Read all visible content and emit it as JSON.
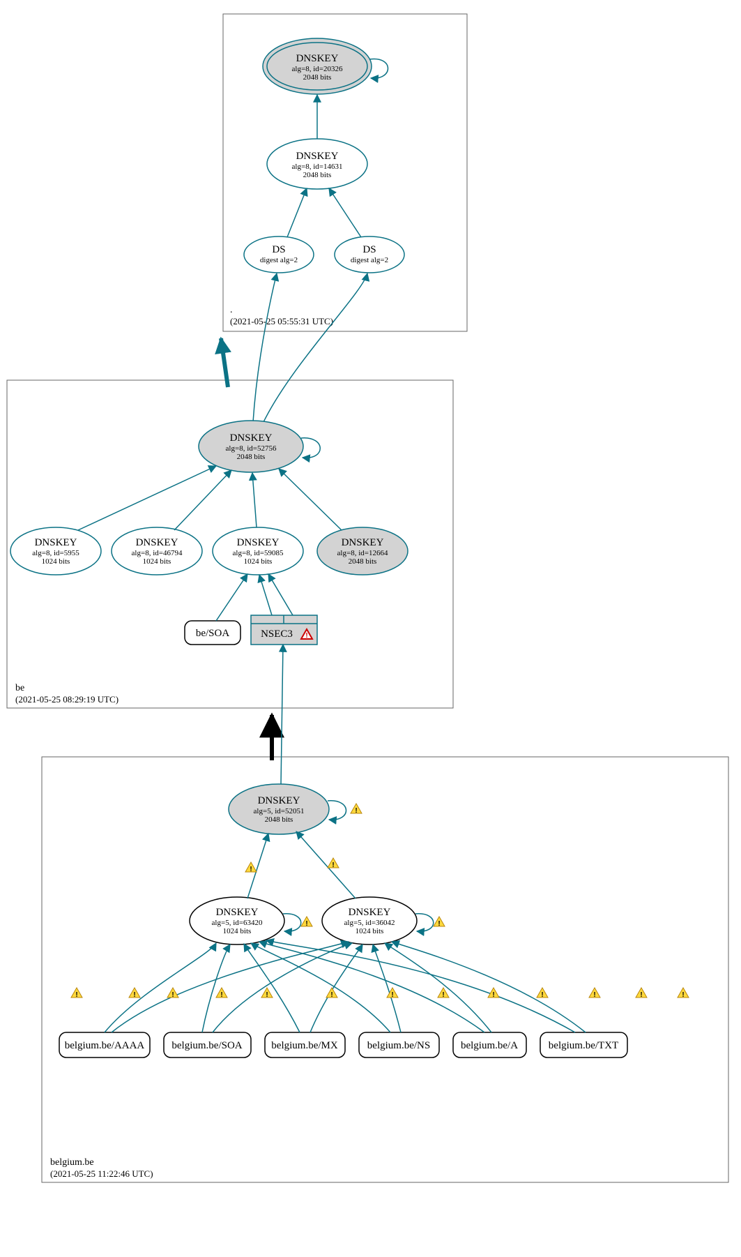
{
  "zones": {
    "root": {
      "label": ".",
      "timestamp": "(2021-05-25 05:55:31 UTC)"
    },
    "be": {
      "label": "be",
      "timestamp": "(2021-05-25 08:29:19 UTC)"
    },
    "belgium": {
      "label": "belgium.be",
      "timestamp": "(2021-05-25 11:22:46 UTC)"
    }
  },
  "nodes": {
    "root_ksk": {
      "title": "DNSKEY",
      "l1": "alg=8, id=20326",
      "l2": "2048 bits"
    },
    "root_zsk": {
      "title": "DNSKEY",
      "l1": "alg=8, id=14631",
      "l2": "2048 bits"
    },
    "root_ds1": {
      "title": "DS",
      "l1": "digest alg=2"
    },
    "root_ds2": {
      "title": "DS",
      "l1": "digest alg=2"
    },
    "be_ksk": {
      "title": "DNSKEY",
      "l1": "alg=8, id=52756",
      "l2": "2048 bits"
    },
    "be_k1": {
      "title": "DNSKEY",
      "l1": "alg=8, id=5955",
      "l2": "1024 bits"
    },
    "be_k2": {
      "title": "DNSKEY",
      "l1": "alg=8, id=46794",
      "l2": "1024 bits"
    },
    "be_k3": {
      "title": "DNSKEY",
      "l1": "alg=8, id=59085",
      "l2": "1024 bits"
    },
    "be_k4": {
      "title": "DNSKEY",
      "l1": "alg=8, id=12664",
      "l2": "2048 bits"
    },
    "be_soa": {
      "title": "be/SOA"
    },
    "be_nsec3": {
      "title": "NSEC3"
    },
    "bg_ksk": {
      "title": "DNSKEY",
      "l1": "alg=5, id=52051",
      "l2": "2048 bits"
    },
    "bg_k1": {
      "title": "DNSKEY",
      "l1": "alg=5, id=63420",
      "l2": "1024 bits"
    },
    "bg_k2": {
      "title": "DNSKEY",
      "l1": "alg=5, id=36042",
      "l2": "1024 bits"
    },
    "rr_aaaa": {
      "title": "belgium.be/AAAA"
    },
    "rr_soa": {
      "title": "belgium.be/SOA"
    },
    "rr_mx": {
      "title": "belgium.be/MX"
    },
    "rr_ns": {
      "title": "belgium.be/NS"
    },
    "rr_a": {
      "title": "belgium.be/A"
    },
    "rr_txt": {
      "title": "belgium.be/TXT"
    }
  },
  "chart_data": {
    "type": "dnssec-auth-graph",
    "zones": [
      {
        "name": ".",
        "checked": "2021-05-25 05:55:31 UTC",
        "keys": [
          {
            "id": 20326,
            "alg": 8,
            "bits": 2048,
            "role": "KSK",
            "trust_anchor": true
          },
          {
            "id": 14631,
            "alg": 8,
            "bits": 2048,
            "role": "ZSK"
          }
        ],
        "ds_for_child": [
          {
            "digest_alg": 2
          },
          {
            "digest_alg": 2
          }
        ]
      },
      {
        "name": "be",
        "checked": "2021-05-25 08:29:19 UTC",
        "keys": [
          {
            "id": 52756,
            "alg": 8,
            "bits": 2048,
            "role": "KSK"
          },
          {
            "id": 5955,
            "alg": 8,
            "bits": 1024
          },
          {
            "id": 46794,
            "alg": 8,
            "bits": 1024
          },
          {
            "id": 59085,
            "alg": 8,
            "bits": 1024,
            "role": "ZSK"
          },
          {
            "id": 12664,
            "alg": 8,
            "bits": 2048,
            "standby": true
          }
        ],
        "rrsets": [
          "be/SOA",
          "NSEC3"
        ],
        "nsec3_warning": true
      },
      {
        "name": "belgium.be",
        "checked": "2021-05-25 11:22:46 UTC",
        "keys": [
          {
            "id": 52051,
            "alg": 5,
            "bits": 2048,
            "role": "KSK",
            "warn": true
          },
          {
            "id": 63420,
            "alg": 5,
            "bits": 1024,
            "role": "ZSK",
            "warn": true
          },
          {
            "id": 36042,
            "alg": 5,
            "bits": 1024,
            "role": "ZSK",
            "warn": true
          }
        ],
        "rrsets": [
          "belgium.be/AAAA",
          "belgium.be/SOA",
          "belgium.be/MX",
          "belgium.be/NS",
          "belgium.be/A",
          "belgium.be/TXT"
        ],
        "all_sig_warnings": true
      }
    ],
    "delegations": [
      {
        "from": ".",
        "to": "be",
        "status": "secure"
      },
      {
        "from": "be",
        "to": "belgium.be",
        "status": "insecure"
      }
    ]
  }
}
